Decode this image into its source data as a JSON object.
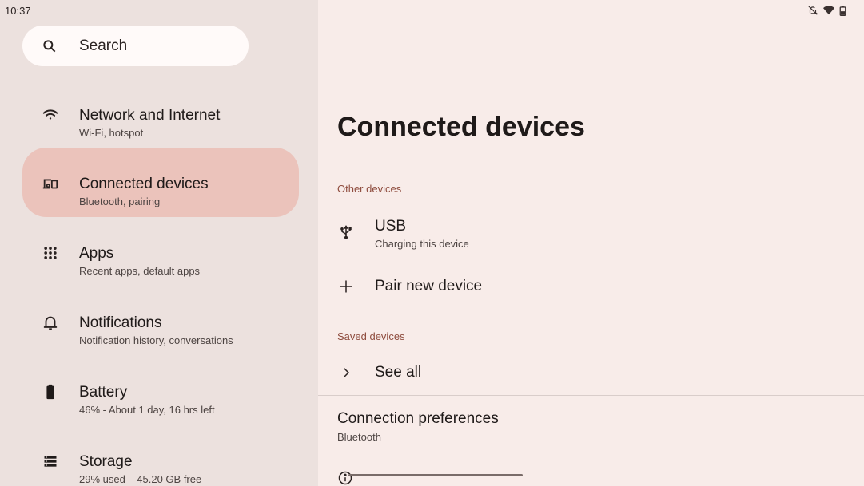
{
  "status": {
    "time": "10:37"
  },
  "search": {
    "placeholder": "Search"
  },
  "nav": [
    {
      "title": "Network and Internet",
      "subtitle": "Wi-Fi, hotspot"
    },
    {
      "title": "Connected devices",
      "subtitle": "Bluetooth, pairing"
    },
    {
      "title": "Apps",
      "subtitle": "Recent apps, default apps"
    },
    {
      "title": "Notifications",
      "subtitle": "Notification history, conversations"
    },
    {
      "title": "Battery",
      "subtitle": "46% - About 1 day, 16 hrs left"
    },
    {
      "title": "Storage",
      "subtitle": "29% used – 45.20 GB free"
    }
  ],
  "page": {
    "title": "Connected devices",
    "other_devices_label": "Other devices",
    "usb": {
      "title": "USB",
      "subtitle": "Charging this device"
    },
    "pair": {
      "title": "Pair new device"
    },
    "saved_devices_label": "Saved devices",
    "see_all": {
      "title": "See all"
    },
    "prefs": {
      "title": "Connection preferences",
      "subtitle": "Bluetooth"
    }
  },
  "colors": {
    "accent": "#8f4d3f",
    "active_bg": "#ebc3bb"
  }
}
